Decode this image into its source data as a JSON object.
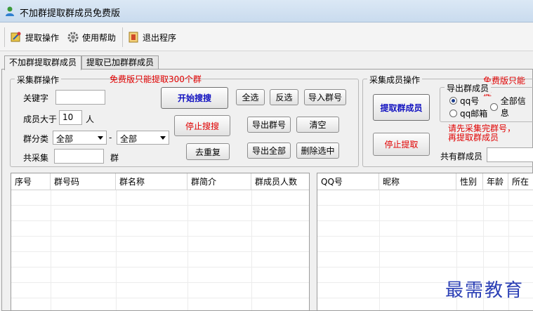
{
  "window": {
    "title": "不加群提取群成员免费版"
  },
  "toolbar": {
    "extract_label": "提取操作",
    "help_label": "使用帮助",
    "exit_label": "退出程序"
  },
  "tabs": [
    "不加群提取群成员",
    "提取已加群群成员"
  ],
  "collect_group": {
    "title": "采集群操作",
    "notice": "免费版只能提取300个群",
    "keyword_label": "关键字",
    "keyword_value": "",
    "members_gt_label": "成员大于",
    "members_gt_value": "10",
    "members_unit": "人",
    "category_label": "群分类",
    "category_value": "全部",
    "subcategory_value": "全部",
    "dash": "-",
    "total_label": "共采集",
    "total_value": "",
    "total_unit": "群",
    "start_search": "开始搜搜",
    "stop_search": "停止搜搜",
    "dedupe": "去重复",
    "select_all": "全选",
    "invert": "反选",
    "import": "导入群号",
    "export_groups": "导出群号",
    "clear": "清空",
    "export_all": "导出全部",
    "delete_selected": "删除选中"
  },
  "collect_members": {
    "title": "采集成员操作",
    "notice": "免费版只能提",
    "extract_members": "提取群成员",
    "stop_extract": "停止提取",
    "export_title": "导出群成员",
    "options": [
      "qq号",
      "全部信息",
      "qq邮箱"
    ],
    "selected_option": "qq号",
    "hint_line1": "请先采集完群号，",
    "hint_line2": "再提取群成员",
    "total_label": "共有群成员",
    "total_value": ""
  },
  "groups_table": {
    "columns": [
      "序号",
      "群号码",
      "群名称",
      "群简介",
      "群成员人数"
    ]
  },
  "members_table": {
    "columns": [
      "QQ号",
      "昵称",
      "性别",
      "年龄",
      "所在"
    ]
  },
  "watermark": "最需教育"
}
